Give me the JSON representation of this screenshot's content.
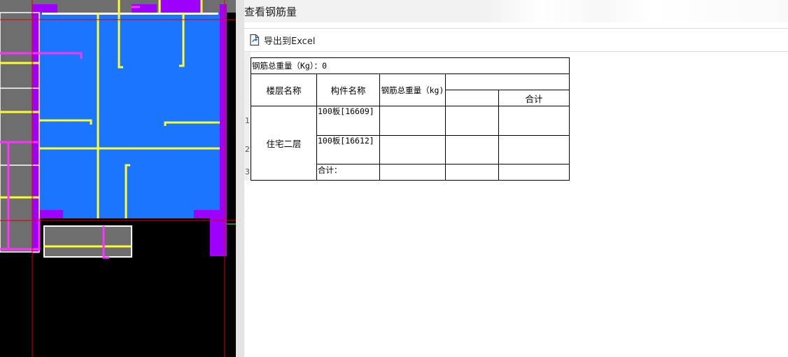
{
  "dialog": {
    "title": "查看钢筋量",
    "toolbar": {
      "export_label": "导出到Excel",
      "export_icon": "export-file-icon"
    }
  },
  "grid": {
    "row_numbers": [
      "1",
      "2",
      "3"
    ],
    "total_weight_label": "钢筋总重量（Kg）：0",
    "headers": {
      "floor_name": "楼层名称",
      "component_name": "构件名称",
      "total_weight": "钢筋总重量（kg)",
      "subtotal": "合计"
    },
    "floor": "住宅二层",
    "rows": [
      {
        "component": "100板[16609]"
      },
      {
        "component": "100板[16612]"
      },
      {
        "component": "合计："
      }
    ]
  },
  "colors": {
    "slab_fill": "#1a75ff",
    "rebar": "#ffff33",
    "wall": "#9d00ff",
    "magenta_line": "#ff33ff",
    "grid_line": "#e00000",
    "gray_fill": "#6e6e6e"
  }
}
